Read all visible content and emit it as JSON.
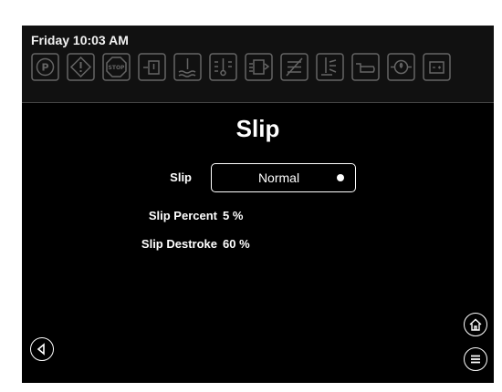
{
  "status": {
    "time": "Friday 10:03 AM"
  },
  "toolbar": {
    "icons": [
      "parking-brake-icon",
      "warning-icon",
      "stop-icon",
      "fuel-warning-icon",
      "coolant-icon",
      "trans-temp-icon",
      "filter-icon",
      "regen-disabled-icon",
      "exhaust-temp-icon",
      "engine-oil-icon",
      "oil-pressure-icon",
      "battery-icon"
    ],
    "stop_label": "STOP"
  },
  "page": {
    "title": "Slip"
  },
  "slip_setting": {
    "label": "Slip",
    "value": "Normal"
  },
  "slip_percent": {
    "label": "Slip Percent",
    "value": "5 %"
  },
  "slip_destroke": {
    "label": "Slip Destroke",
    "value": "60 %"
  },
  "nav": {
    "back": "back-icon",
    "home": "home-icon",
    "menu": "menu-icon"
  },
  "colors": {
    "background": "#000000",
    "text": "#ffffff",
    "icon": "#8c8c8c"
  }
}
